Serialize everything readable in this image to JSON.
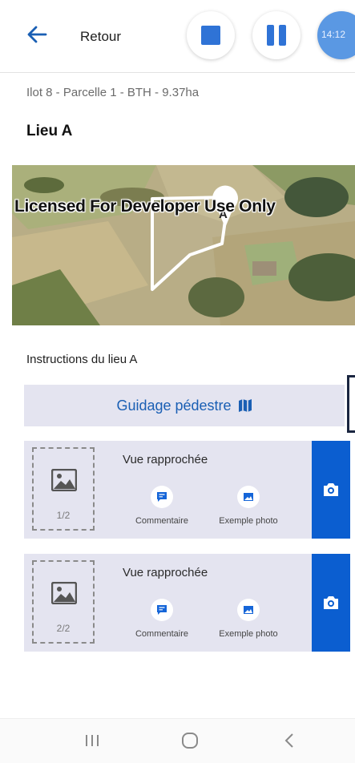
{
  "header": {
    "back_label": "Retour",
    "timer": "14:12",
    "accent": "#2f73d6"
  },
  "breadcrumb": "Ilot 8 - Parcelle 1 - BTH - 9.37ha",
  "place_title": "Lieu A",
  "map": {
    "watermark": "Licensed For Developer Use Only",
    "marker_label": "A"
  },
  "instructions_title": "Instructions du lieu A",
  "guide_button": {
    "label": "Guidage pédestre",
    "icon": "map-icon"
  },
  "photo_cards": [
    {
      "title": "Vue rapprochée",
      "count": "1/2",
      "comment_label": "Commentaire",
      "example_label": "Exemple photo"
    },
    {
      "title": "Vue rapprochée",
      "count": "2/2",
      "comment_label": "Commentaire",
      "example_label": "Exemple photo"
    }
  ],
  "colors": {
    "card_bg": "#e4e4f0",
    "camera_bg": "#0b5ed0",
    "link": "#1a5fb4"
  },
  "bottom_nav": {
    "icons": [
      "recent-apps-icon",
      "home-icon",
      "back-icon"
    ]
  }
}
